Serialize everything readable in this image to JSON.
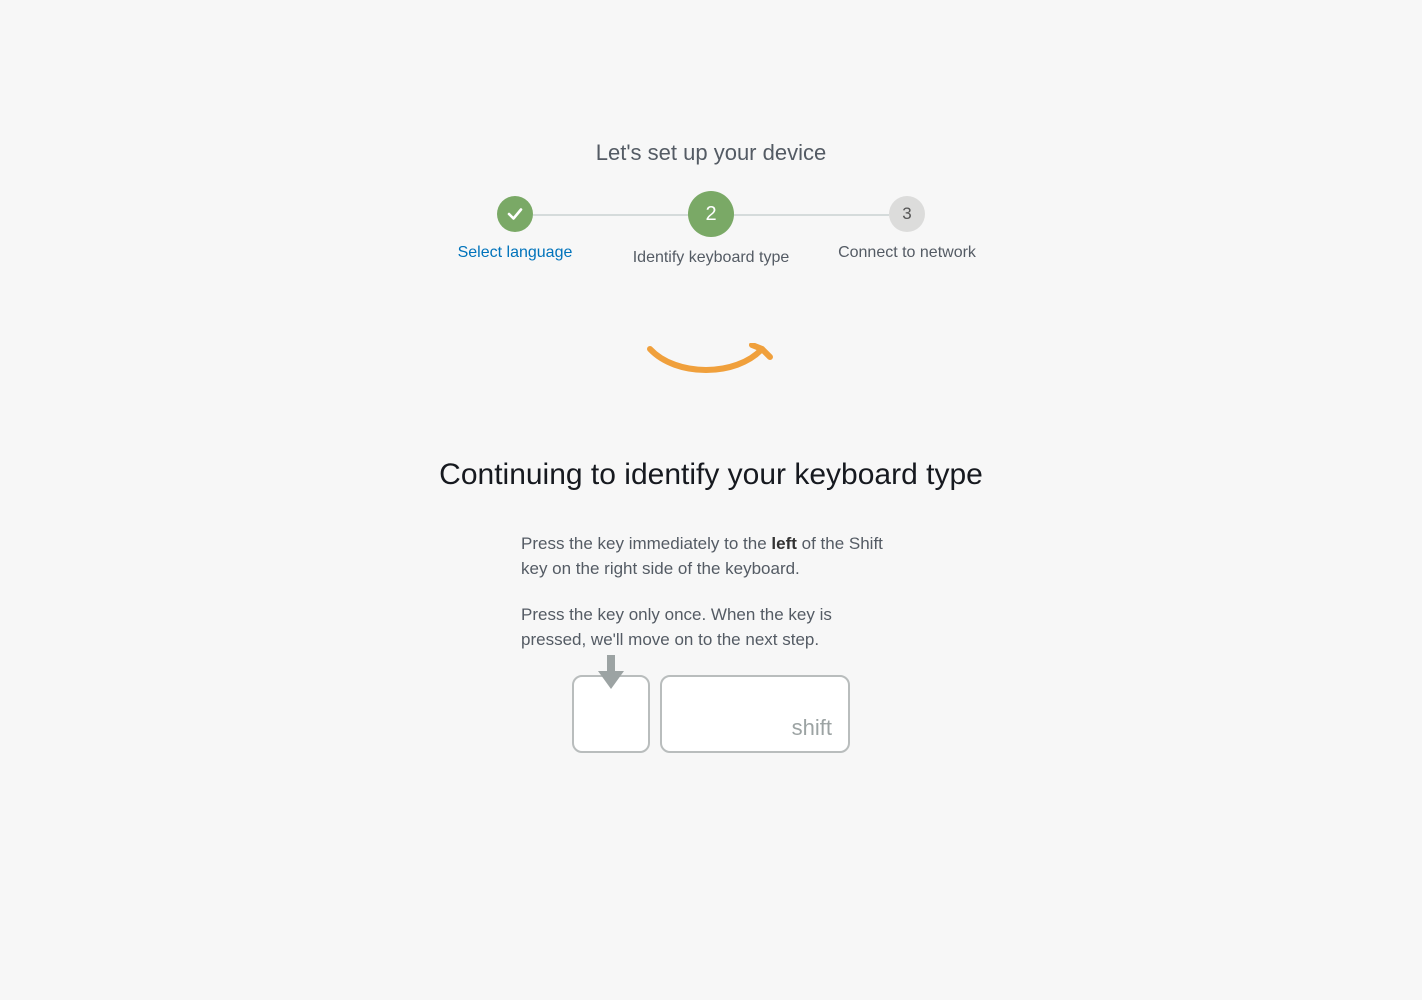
{
  "title": "Let's set up your device",
  "steps": {
    "s1": {
      "label": "Select language"
    },
    "s2": {
      "number": "2",
      "label": "Identify keyboard type"
    },
    "s3": {
      "number": "3",
      "label": "Connect to network"
    }
  },
  "heading": "Continuing to identify your keyboard type",
  "instruction1_pre": "Press the key immediately to the ",
  "instruction1_bold": "left",
  "instruction1_post": " of the Shift key on the right side of the keyboard.",
  "instruction2": "Press the key only once. When the key is pressed, we'll move on to the next step.",
  "shift_label": "shift",
  "colors": {
    "accent_green": "#7AA966",
    "link_blue": "#0073BB",
    "amazon_orange": "#F0A03C"
  }
}
